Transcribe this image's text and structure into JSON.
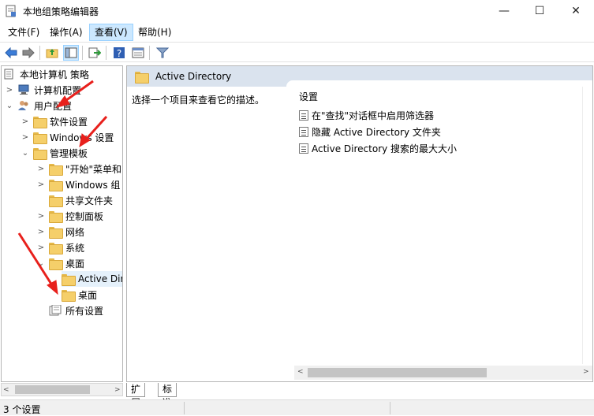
{
  "window": {
    "title": "本地组策略编辑器",
    "minimize": "—",
    "maximize": "☐",
    "close": "✕"
  },
  "menu": [
    "文件(F)",
    "操作(A)",
    "查看(V)",
    "帮助(H)"
  ],
  "toolbar": {
    "icons": [
      "back-icon",
      "forward-icon",
      "up-folder-icon",
      "show-hide-tree-icon",
      "export-list-icon",
      "help-icon",
      "properties-icon",
      "filter-icon"
    ]
  },
  "tree": {
    "root": "本地计算机 策略",
    "computer_config": "计算机配置",
    "user_config": "用户配置",
    "software_settings": "软件设置",
    "windows_settings": "Windows 设置",
    "admin_templates": "管理模板",
    "start_menu": "\"开始\"菜单和",
    "windows_components": "Windows 组",
    "shared_folders": "共享文件夹",
    "control_panel": "控制面板",
    "network": "网络",
    "system": "系统",
    "desktop": "桌面",
    "active_directory": "Active Dir",
    "desktop_sub": "桌面",
    "all_settings": "所有设置"
  },
  "right": {
    "header": "Active Directory",
    "description": "选择一个项目来查看它的描述。",
    "column": "设置",
    "settings": [
      "在\"查找\"对话框中启用筛选器",
      "隐藏 Active Directory 文件夹",
      "Active Directory 搜索的最大大小"
    ]
  },
  "tabs": [
    "扩展",
    "标准"
  ],
  "status": "3 个设置",
  "colors": {
    "header_bg": "#dae3ee",
    "selected_bg": "#e5f1fb",
    "menu_active": "#cce8ff",
    "arrow": "#e8201c"
  }
}
